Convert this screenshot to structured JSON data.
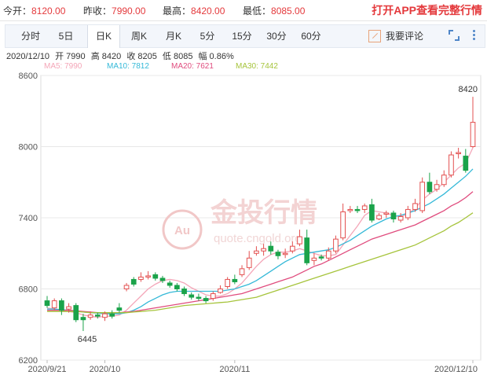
{
  "quote": {
    "open_label": "今开：",
    "open_value": "8120.00",
    "prev_close_label": "昨收：",
    "prev_close_value": "7990.00",
    "high_label": "最高：",
    "high_value": "8420.00",
    "low_label": "最低：",
    "low_value": "8085.00",
    "promo": "打开APP查看完整行情"
  },
  "toolbar": {
    "tabs": [
      {
        "label": "分时"
      },
      {
        "label": "5日"
      },
      {
        "label": "日K"
      },
      {
        "label": "周K"
      },
      {
        "label": "月K"
      },
      {
        "label": "5分"
      },
      {
        "label": "15分"
      },
      {
        "label": "30分"
      },
      {
        "label": "60分"
      }
    ],
    "active_tab": "日K",
    "comment_label": "我要评论",
    "icons": [
      "pen-icon",
      "expand-icon",
      "more-icon"
    ]
  },
  "info": {
    "date": "2020/12/10",
    "open": "开 7990",
    "high": "高 8420",
    "close": "收 8205",
    "low": "低 8085",
    "change": "幅 0.86%"
  },
  "ma_legend": [
    {
      "label": "MA5: 7990",
      "color": "#f4a6b8"
    },
    {
      "label": "MA10: 7812",
      "color": "#35b9d8"
    },
    {
      "label": "MA20: 7621",
      "color": "#e04c7e"
    },
    {
      "label": "MA30: 7442",
      "color": "#a6c43c"
    }
  ],
  "watermark": {
    "text_cn": "金投行情",
    "text_en": "quote.cngold.org",
    "logo": "Au"
  },
  "colors": {
    "up": "#e35050",
    "down": "#1aa34a",
    "grid": "#e8e8e8",
    "axis_text": "#555"
  },
  "chart_data": {
    "type": "candlestick",
    "y_ticks": [
      6200,
      6800,
      7400,
      8000,
      8600
    ],
    "ylim": [
      6200,
      8600
    ],
    "x_tick_labels": [
      {
        "label": "2020/9/21",
        "index": 0
      },
      {
        "label": "2020/10",
        "index": 8
      },
      {
        "label": "2020/11",
        "index": 26
      },
      {
        "label": "2020/12/10",
        "index": 59
      }
    ],
    "annotations": [
      {
        "text": "8420",
        "index": 59,
        "value": 8420
      },
      {
        "text": "6445",
        "index": 4,
        "value": 6445
      }
    ],
    "candles": [
      [
        6700,
        6660,
        6740,
        6640
      ],
      [
        6640,
        6700,
        6720,
        6620
      ],
      [
        6700,
        6620,
        6720,
        6580
      ],
      [
        6630,
        6650,
        6680,
        6600
      ],
      [
        6660,
        6540,
        6680,
        6520
      ],
      [
        6560,
        6540,
        6590,
        6445
      ],
      [
        6560,
        6580,
        6610,
        6540
      ],
      [
        6580,
        6570,
        6600,
        6550
      ],
      [
        6560,
        6590,
        6610,
        6530
      ],
      [
        6590,
        6570,
        6620,
        6550
      ],
      [
        6640,
        6620,
        6680,
        6600
      ],
      [
        6800,
        6830,
        6850,
        6780
      ],
      [
        6880,
        6840,
        6900,
        6820
      ],
      [
        6880,
        6900,
        6940,
        6860
      ],
      [
        6900,
        6910,
        6950,
        6880
      ],
      [
        6920,
        6890,
        6940,
        6870
      ],
      [
        6890,
        6870,
        6910,
        6850
      ],
      [
        6850,
        6830,
        6870,
        6810
      ],
      [
        6830,
        6800,
        6850,
        6780
      ],
      [
        6800,
        6760,
        6820,
        6740
      ],
      [
        6750,
        6730,
        6770,
        6710
      ],
      [
        6730,
        6720,
        6760,
        6700
      ],
      [
        6720,
        6700,
        6740,
        6680
      ],
      [
        6720,
        6760,
        6780,
        6700
      ],
      [
        6770,
        6800,
        6830,
        6760
      ],
      [
        6820,
        6880,
        6900,
        6800
      ],
      [
        6880,
        6860,
        6920,
        6840
      ],
      [
        6920,
        6970,
        7000,
        6900
      ],
      [
        6980,
        7060,
        7120,
        6960
      ],
      [
        7100,
        7120,
        7160,
        7080
      ],
      [
        7120,
        7140,
        7180,
        7080
      ],
      [
        7160,
        7120,
        7200,
        7090
      ],
      [
        7110,
        7080,
        7130,
        7050
      ],
      [
        7090,
        7100,
        7140,
        7060
      ],
      [
        7120,
        7160,
        7200,
        7100
      ],
      [
        7180,
        7240,
        7300,
        7160
      ],
      [
        7230,
        7020,
        7300,
        7000
      ],
      [
        7040,
        7060,
        7100,
        7000
      ],
      [
        7070,
        7060,
        7090,
        7040
      ],
      [
        7060,
        7120,
        7150,
        7040
      ],
      [
        7120,
        7220,
        7250,
        7100
      ],
      [
        7230,
        7450,
        7520,
        7210
      ],
      [
        7460,
        7470,
        7500,
        7440
      ],
      [
        7470,
        7460,
        7500,
        7440
      ],
      [
        7470,
        7500,
        7520,
        7440
      ],
      [
        7510,
        7380,
        7560,
        7360
      ],
      [
        7390,
        7420,
        7440,
        7380
      ],
      [
        7430,
        7440,
        7460,
        7400
      ],
      [
        7440,
        7390,
        7460,
        7360
      ],
      [
        7380,
        7410,
        7440,
        7360
      ],
      [
        7400,
        7470,
        7500,
        7380
      ],
      [
        7470,
        7520,
        7560,
        7450
      ],
      [
        7460,
        7700,
        7740,
        7440
      ],
      [
        7700,
        7620,
        7780,
        7600
      ],
      [
        7640,
        7680,
        7720,
        7620
      ],
      [
        7680,
        7760,
        7800,
        7660
      ],
      [
        7760,
        7930,
        7960,
        7740
      ],
      [
        7940,
        7950,
        7990,
        7900
      ],
      [
        7920,
        7800,
        7980,
        7780
      ],
      [
        8000,
        8205,
        8420,
        7990
      ]
    ],
    "series": [
      {
        "name": "MA5",
        "color": "#f4a6b8",
        "values": [
          6640,
          6630,
          6620,
          6610,
          6600,
          6580,
          6570,
          6560,
          6570,
          6570,
          6580,
          6620,
          6680,
          6740,
          6800,
          6840,
          6870,
          6880,
          6870,
          6850,
          6810,
          6780,
          6750,
          6740,
          6740,
          6760,
          6800,
          6850,
          6920,
          6990,
          7050,
          7090,
          7110,
          7110,
          7120,
          7140,
          7120,
          7100,
          7080,
          7080,
          7090,
          7170,
          7250,
          7330,
          7420,
          7460,
          7450,
          7440,
          7420,
          7410,
          7430,
          7480,
          7550,
          7600,
          7640,
          7700,
          7760,
          7820,
          7860,
          7990
        ]
      },
      {
        "name": "MA10",
        "color": "#35b9d8",
        "values": [
          6630,
          6630,
          6625,
          6620,
          6615,
          6605,
          6600,
          6595,
          6590,
          6590,
          6590,
          6600,
          6620,
          6650,
          6690,
          6720,
          6750,
          6770,
          6780,
          6780,
          6780,
          6780,
          6780,
          6780,
          6780,
          6790,
          6800,
          6820,
          6840,
          6870,
          6910,
          6950,
          6990,
          7030,
          7060,
          7090,
          7100,
          7110,
          7120,
          7130,
          7150,
          7180,
          7210,
          7250,
          7290,
          7330,
          7360,
          7390,
          7410,
          7420,
          7440,
          7460,
          7490,
          7520,
          7560,
          7600,
          7650,
          7700,
          7750,
          7812
        ]
      },
      {
        "name": "MA20",
        "color": "#e04c7e",
        "values": [
          6620,
          6620,
          6620,
          6620,
          6615,
          6610,
          6605,
          6600,
          6600,
          6600,
          6600,
          6605,
          6610,
          6620,
          6630,
          6640,
          6650,
          6660,
          6670,
          6680,
          6690,
          6700,
          6710,
          6720,
          6730,
          6740,
          6750,
          6760,
          6780,
          6800,
          6820,
          6840,
          6860,
          6880,
          6900,
          6930,
          6960,
          6990,
          7010,
          7040,
          7070,
          7100,
          7130,
          7160,
          7190,
          7220,
          7240,
          7260,
          7280,
          7300,
          7320,
          7340,
          7370,
          7400,
          7430,
          7460,
          7500,
          7530,
          7570,
          7621
        ]
      },
      {
        "name": "MA30",
        "color": "#a6c43c",
        "values": [
          6610,
          6610,
          6610,
          6610,
          6610,
          6605,
          6600,
          6600,
          6600,
          6600,
          6600,
          6600,
          6605,
          6610,
          6615,
          6620,
          6630,
          6640,
          6650,
          6660,
          6665,
          6670,
          6675,
          6680,
          6685,
          6690,
          6700,
          6710,
          6720,
          6730,
          6750,
          6770,
          6790,
          6810,
          6830,
          6850,
          6870,
          6890,
          6910,
          6930,
          6950,
          6970,
          6990,
          7010,
          7030,
          7050,
          7070,
          7090,
          7110,
          7130,
          7150,
          7170,
          7200,
          7230,
          7260,
          7290,
          7330,
          7360,
          7400,
          7442
        ]
      }
    ]
  }
}
